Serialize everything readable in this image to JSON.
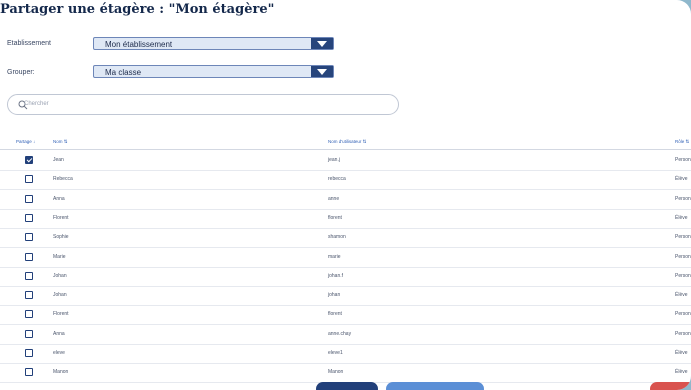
{
  "title": "Partager une étagère : \"Mon étagère\"",
  "filters": {
    "etablissement": {
      "label": "Etablissement",
      "value": "Mon établissement"
    },
    "grouper": {
      "label": "Grouper:",
      "value": "Ma classe"
    }
  },
  "search": {
    "placeholder": "Chercher"
  },
  "table": {
    "headers": {
      "partage": "Partage ↓",
      "nom": "Nom ⇅",
      "username": "Nom d'utilisateur ⇅",
      "role": "Rôle ⇅"
    },
    "rows": [
      {
        "checked": true,
        "nom": "Jean",
        "username": "jean.j",
        "role": "Personnel"
      },
      {
        "checked": false,
        "nom": "Rebecca",
        "username": "rebecca",
        "role": "Élève"
      },
      {
        "checked": false,
        "nom": "Anna",
        "username": "anne",
        "role": "Personnel"
      },
      {
        "checked": false,
        "nom": "Florent",
        "username": "florent",
        "role": "Élève"
      },
      {
        "checked": false,
        "nom": "Sophie",
        "username": "shamon",
        "role": "Personnel"
      },
      {
        "checked": false,
        "nom": "Marie",
        "username": "marie",
        "role": "Personnel"
      },
      {
        "checked": false,
        "nom": "Johan",
        "username": "johan.f",
        "role": "Personnel"
      },
      {
        "checked": false,
        "nom": "Johan",
        "username": "johan",
        "role": "Élève"
      },
      {
        "checked": false,
        "nom": "Florent",
        "username": "florent",
        "role": "Personnel"
      },
      {
        "checked": false,
        "nom": "Anna",
        "username": "anne.chay",
        "role": "Personnel"
      },
      {
        "checked": false,
        "nom": "eleve",
        "username": "eleve1",
        "role": "Élève"
      },
      {
        "checked": false,
        "nom": "Manon",
        "username": "Manon",
        "role": "Élève"
      }
    ]
  },
  "colors": {
    "primary": "#22407a",
    "accent": "#2f5fb5",
    "danger": "#d9534f",
    "secondary": "#5b8fd6"
  }
}
